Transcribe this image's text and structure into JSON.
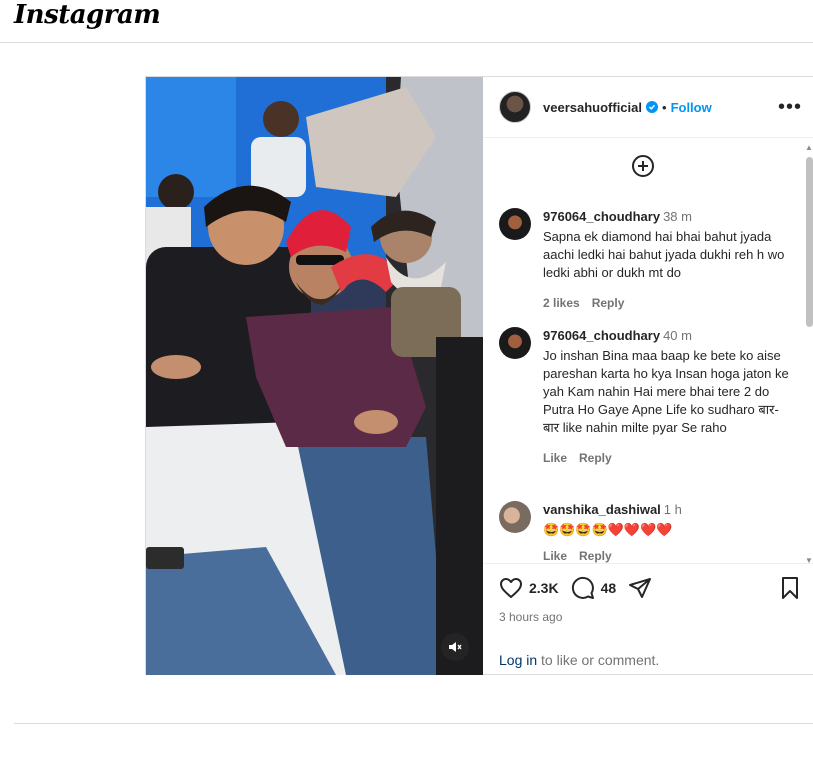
{
  "app": {
    "logo_text": "Instagram"
  },
  "post": {
    "username": "veersahuofficial",
    "separator": "•",
    "follow_label": "Follow",
    "more_glyph": "•••",
    "likes": "2.3K",
    "comment_count": "48",
    "posted_time": "3 hours ago",
    "login_link": "Log in",
    "login_suffix": " to like or comment."
  },
  "comments": [
    {
      "user": "976064_choudhary",
      "time": "38 m",
      "text": "Sapna ek diamond hai bhai bahut jyada aachi ledki hai bahut jyada dukhi reh h wo ledki abhi or dukh mt do",
      "likes_label": "2 likes",
      "reply_label": "Reply"
    },
    {
      "user": "976064_choudhary",
      "time": "40 m",
      "text": "Jo inshan Bina maa baap ke bete ko aise pareshan karta ho kya Insan hoga jaton ke yah Kam nahin Hai mere bhai tere 2 do Putra Ho Gaye Apne Life ko sudharo बार-बार like nahin milte pyar Se raho",
      "likes_label": "Like",
      "reply_label": "Reply"
    },
    {
      "user": "vanshika_dashiwal",
      "time": "1 h",
      "text": "🤩🤩🤩🤩❤️❤️❤️❤️",
      "likes_label": "Like",
      "reply_label": "Reply"
    }
  ],
  "icons": {
    "add": "add-comment-icon",
    "like": "heart-icon",
    "comment": "comment-bubble-icon",
    "share": "share-plane-icon",
    "save": "bookmark-icon",
    "mute": "speaker-muted-icon",
    "verified": "verified-badge-icon"
  },
  "colors": {
    "accent": "#0095f6",
    "link": "#00376b",
    "secondary": "#737373",
    "border": "#dbdbdb"
  }
}
